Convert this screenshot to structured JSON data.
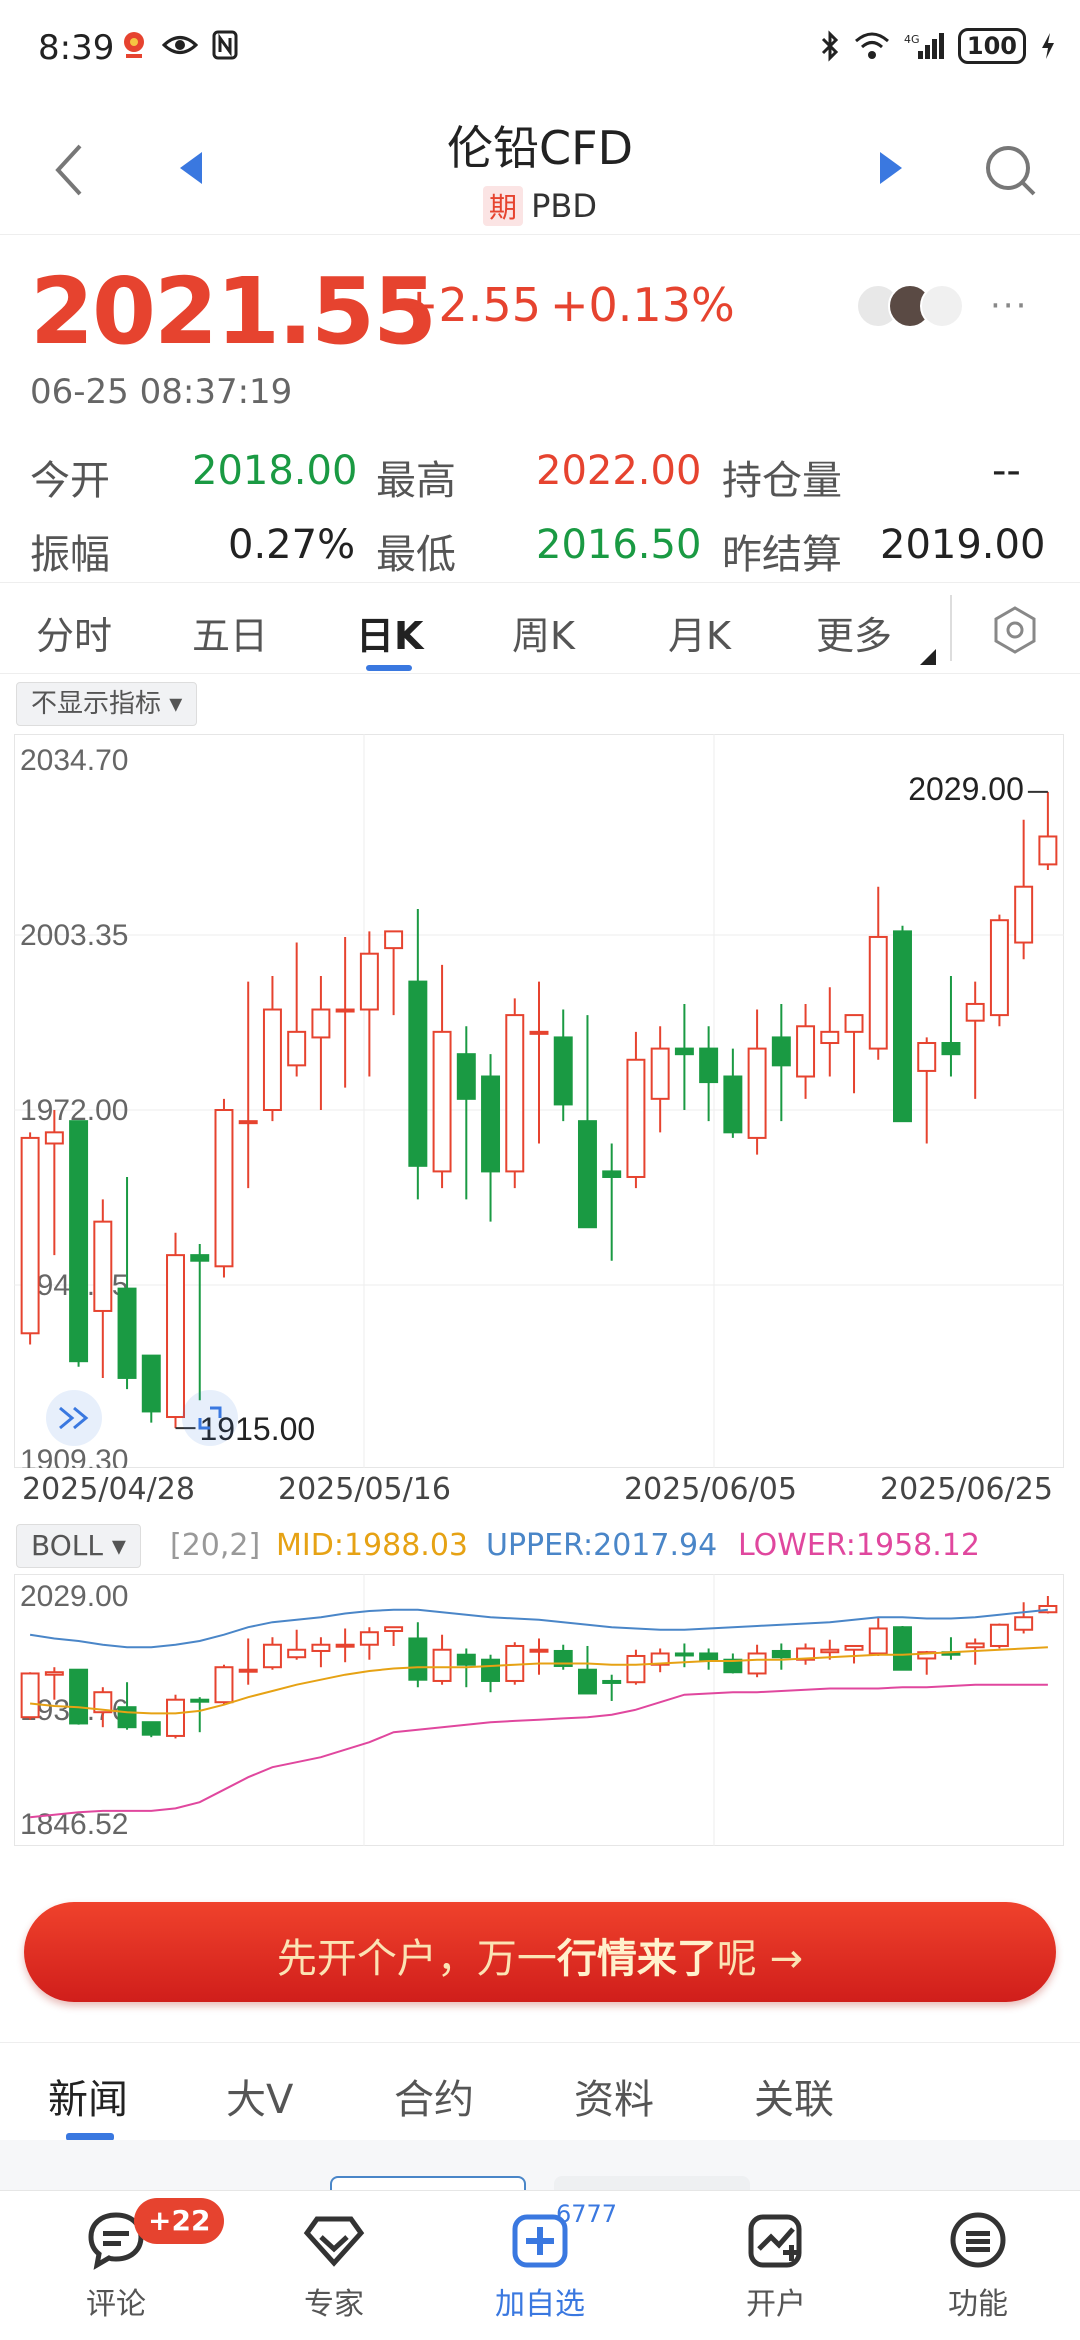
{
  "status": {
    "time": "8:39",
    "battery": "100"
  },
  "header": {
    "title": "伦铅CFD",
    "badge": "期",
    "symbol": "PBD"
  },
  "quote": {
    "price": "2021.55",
    "change": "+2.55",
    "change_pct": "+0.13%",
    "timestamp": "06-25 08:37:19",
    "more": "···",
    "fields": {
      "open_label": "今开",
      "open": "2018.00",
      "high_label": "最高",
      "high": "2022.00",
      "oi_label": "持仓量",
      "oi": "--",
      "amp_label": "振幅",
      "amp": "0.27%",
      "low_label": "最低",
      "low": "2016.50",
      "prev_label": "昨结算",
      "prev": "2019.00"
    }
  },
  "period_tabs": [
    "分时",
    "五日",
    "日K",
    "周K",
    "月K",
    "更多"
  ],
  "indicator_toggle": "不显示指标 ▾",
  "chart_data": [
    {
      "type": "candlestick",
      "y_ticks": [
        "2034.70",
        "2003.35",
        "1972.00",
        "1940.65",
        "1909.30"
      ],
      "ylim": [
        1909.3,
        2034.7
      ],
      "x_labels": [
        "2025/04/28",
        "2025/05/16",
        "2025/06/05",
        "2025/06/25"
      ],
      "max_marker": "2029.00",
      "min_marker": "1915.00",
      "candles": [
        {
          "o": 1932,
          "h": 1968,
          "l": 1930,
          "c": 1967
        },
        {
          "o": 1966,
          "h": 1972,
          "l": 1946,
          "c": 1968
        },
        {
          "o": 1970,
          "h": 1970,
          "l": 1926,
          "c": 1927
        },
        {
          "o": 1936,
          "h": 1956,
          "l": 1924,
          "c": 1952
        },
        {
          "o": 1940,
          "h": 1960,
          "l": 1922,
          "c": 1924
        },
        {
          "o": 1928,
          "h": 1928,
          "l": 1916,
          "c": 1918
        },
        {
          "o": 1917,
          "h": 1950,
          "l": 1915,
          "c": 1946
        },
        {
          "o": 1946,
          "h": 1948,
          "l": 1920,
          "c": 1945
        },
        {
          "o": 1944,
          "h": 1974,
          "l": 1942,
          "c": 1972
        },
        {
          "o": 1970,
          "h": 1995,
          "l": 1958,
          "c": 1970
        },
        {
          "o": 1972,
          "h": 1996,
          "l": 1970,
          "c": 1990
        },
        {
          "o": 1980,
          "h": 2002,
          "l": 1978,
          "c": 1986
        },
        {
          "o": 1985,
          "h": 1996,
          "l": 1972,
          "c": 1990
        },
        {
          "o": 1990,
          "h": 2003,
          "l": 1976,
          "c": 1990
        },
        {
          "o": 1990,
          "h": 2004,
          "l": 1978,
          "c": 2000
        },
        {
          "o": 2001,
          "h": 2004,
          "l": 1989,
          "c": 2004
        },
        {
          "o": 1995,
          "h": 2008,
          "l": 1956,
          "c": 1962
        },
        {
          "o": 1961,
          "h": 1998,
          "l": 1958,
          "c": 1986
        },
        {
          "o": 1982,
          "h": 1987,
          "l": 1956,
          "c": 1974
        },
        {
          "o": 1978,
          "h": 1982,
          "l": 1952,
          "c": 1961
        },
        {
          "o": 1961,
          "h": 1992,
          "l": 1958,
          "c": 1989
        },
        {
          "o": 1986,
          "h": 1995,
          "l": 1966,
          "c": 1986
        },
        {
          "o": 1985,
          "h": 1990,
          "l": 1970,
          "c": 1973
        },
        {
          "o": 1970,
          "h": 1989,
          "l": 1955,
          "c": 1951
        },
        {
          "o": 1961,
          "h": 1966,
          "l": 1945,
          "c": 1960
        },
        {
          "o": 1960,
          "h": 1986,
          "l": 1958,
          "c": 1981
        },
        {
          "o": 1974,
          "h": 1987,
          "l": 1968,
          "c": 1983
        },
        {
          "o": 1983,
          "h": 1991,
          "l": 1972,
          "c": 1982
        },
        {
          "o": 1983,
          "h": 1987,
          "l": 1970,
          "c": 1977
        },
        {
          "o": 1978,
          "h": 1983,
          "l": 1967,
          "c": 1968
        },
        {
          "o": 1967,
          "h": 1990,
          "l": 1964,
          "c": 1983
        },
        {
          "o": 1985,
          "h": 1991,
          "l": 1970,
          "c": 1980
        },
        {
          "o": 1978,
          "h": 1991,
          "l": 1974,
          "c": 1987
        },
        {
          "o": 1984,
          "h": 1994,
          "l": 1978,
          "c": 1986
        },
        {
          "o": 1986,
          "h": 1989,
          "l": 1975,
          "c": 1989
        },
        {
          "o": 1983,
          "h": 2012,
          "l": 1981,
          "c": 2003
        },
        {
          "o": 2004,
          "h": 2005,
          "l": 1970,
          "c": 1970
        },
        {
          "o": 1979,
          "h": 1985,
          "l": 1966,
          "c": 1984
        },
        {
          "o": 1984,
          "h": 1996,
          "l": 1978,
          "c": 1982
        },
        {
          "o": 1988,
          "h": 1995,
          "l": 1974,
          "c": 1991
        },
        {
          "o": 1989,
          "h": 2007,
          "l": 1987,
          "c": 2006
        },
        {
          "o": 2002,
          "h": 2024,
          "l": 1999,
          "c": 2012
        },
        {
          "o": 2016,
          "h": 2029,
          "l": 2015,
          "c": 2021
        }
      ]
    },
    {
      "type": "line",
      "indicator": "BOLL",
      "params": "[20,2]",
      "mid_label": "MID:1988.03",
      "upper_label": "UPPER:2017.94",
      "lower_label": "LOWER:1958.12",
      "y_ticks": [
        "2029.00",
        "1937.76",
        "1846.52"
      ],
      "ylim": [
        1846.52,
        2029.0
      ],
      "upper": [
        1998,
        1995,
        1993,
        1990,
        1988,
        1988,
        1990,
        1993,
        1998,
        2004,
        2008,
        2010,
        2012,
        2015,
        2017,
        2018,
        2018,
        2016,
        2014,
        2012,
        2011,
        2010,
        2008,
        2006,
        2004,
        2003,
        2002,
        2002,
        2003,
        2004,
        2005,
        2006,
        2007,
        2008,
        2010,
        2012,
        2012,
        2011,
        2011,
        2012,
        2014,
        2016,
        2018
      ],
      "mid": [
        1943,
        1941,
        1940,
        1938,
        1936,
        1935,
        1935,
        1937,
        1942,
        1948,
        1953,
        1958,
        1962,
        1966,
        1969,
        1971,
        1972,
        1972,
        1972,
        1973,
        1974,
        1975,
        1975,
        1975,
        1974,
        1974,
        1975,
        1976,
        1977,
        1977,
        1978,
        1978,
        1979,
        1980,
        1981,
        1982,
        1982,
        1983,
        1984,
        1985,
        1986,
        1987,
        1988
      ],
      "lower": [
        1852,
        1854,
        1856,
        1857,
        1857,
        1857,
        1859,
        1864,
        1874,
        1884,
        1892,
        1896,
        1900,
        1906,
        1912,
        1920,
        1922,
        1924,
        1926,
        1928,
        1929,
        1930,
        1931,
        1932,
        1934,
        1938,
        1944,
        1950,
        1951,
        1952,
        1952,
        1953,
        1954,
        1955,
        1955,
        1955,
        1956,
        1956,
        1957,
        1958,
        1958,
        1958,
        1958
      ]
    }
  ],
  "promo": {
    "text_a": "先开个户，万一",
    "text_b": "行情来了",
    "text_c": "呢 →"
  },
  "news_tabs": [
    "新闻",
    "大V",
    "合约",
    "资料",
    "关联"
  ],
  "bottom_nav": {
    "comment_label": "评论",
    "comment_badge": "+22",
    "expert_label": "专家",
    "fav_label": "加自选",
    "fav_count": "6777",
    "account_label": "开户",
    "function_label": "功能"
  },
  "colors": {
    "up": "#e6432f",
    "down": "#1a9a43",
    "accent": "#3a78e0",
    "mid": "#e6a214",
    "upper": "#4a86c8",
    "lower": "#e0479e"
  }
}
